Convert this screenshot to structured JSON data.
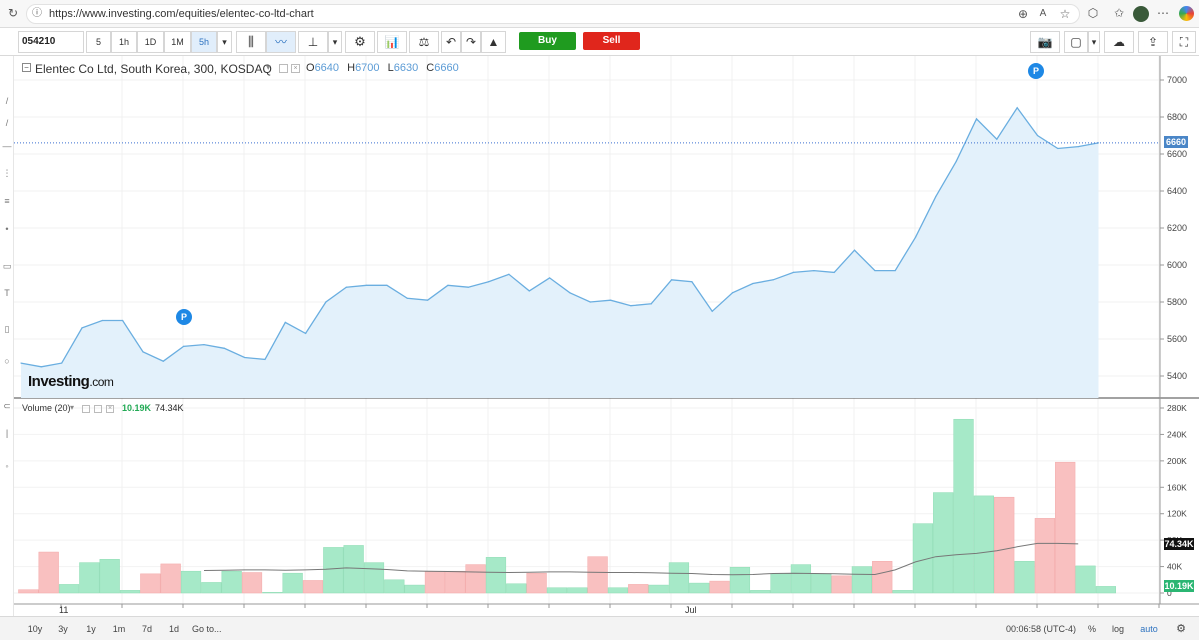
{
  "browser": {
    "url": "https://www.investing.com/equities/elentec-co-ltd-chart"
  },
  "toolbar": {
    "symbol": "054210",
    "intervals": [
      "5",
      "1h",
      "1D",
      "1M",
      "5h"
    ],
    "active_interval": "5h",
    "buy_label": "Buy",
    "sell_label": "Sell"
  },
  "legend": {
    "title": "Elentec Co Ltd, South Korea, 300, KOSDAQ",
    "open_label": "O",
    "open": "6640",
    "high_label": "H",
    "high": "6700",
    "low_label": "L",
    "low": "6630",
    "close_label": "C",
    "close": "6660"
  },
  "volume_legend": {
    "title": "Volume (20)",
    "volume": "10.19K",
    "ma": "74.34K"
  },
  "watermark": {
    "brand": "Investing",
    "suffix": ".com"
  },
  "event_badges": [
    "P",
    "P"
  ],
  "price_badge": "6660",
  "volume_badges": {
    "ma": "74.34K",
    "volume": "10.19K"
  },
  "x_labels": [
    "11",
    "Jul"
  ],
  "bottom_bar": {
    "ranges": [
      "10y",
      "3y",
      "1y",
      "1m",
      "7d",
      "1d"
    ],
    "goto": "Go to...",
    "time": "00:06:58 (UTC-4)",
    "percent": "%",
    "log": "log",
    "auto": "auto"
  },
  "colors": {
    "price_line": "#6aaee0",
    "price_fill": "#e3f1fb",
    "vol_up": "#a6e9c8",
    "vol_down": "#f9c0c0",
    "buy": "#1f9b1f",
    "sell": "#e0261c",
    "badge_blue": "#1e88e5"
  },
  "chart_data": [
    {
      "type": "area",
      "title": "Elentec Co Ltd, South Korea, 300, KOSDAQ",
      "y_ticks": [
        5400,
        5600,
        5800,
        6000,
        6200,
        6400,
        6600,
        6800,
        7000
      ],
      "ylim": [
        5290,
        7090
      ],
      "values": [
        5470,
        5450,
        5470,
        5660,
        5700,
        5700,
        5530,
        5480,
        5560,
        5570,
        5550,
        5500,
        5490,
        5690,
        5630,
        5800,
        5880,
        5890,
        5890,
        5820,
        5810,
        5890,
        5880,
        5910,
        5950,
        5860,
        5930,
        5850,
        5800,
        5810,
        5780,
        5790,
        5920,
        5910,
        5750,
        5850,
        5900,
        5920,
        5960,
        5970,
        5960,
        6080,
        5970,
        5970,
        6150,
        6370,
        6560,
        6790,
        6680,
        6850,
        6700,
        6630,
        6640,
        6660
      ],
      "last_price_line": 6660,
      "grid": true
    },
    {
      "type": "bar",
      "title": "Volume (20)",
      "y_ticks": [
        "0",
        "40K",
        "80K",
        "120K",
        "160K",
        "200K",
        "240K",
        "280K"
      ],
      "ylim": [
        0,
        285000
      ],
      "volumes": [
        5000,
        62000,
        13000,
        46000,
        51000,
        4000,
        29000,
        44000,
        33000,
        16000,
        33000,
        31000,
        1000,
        30000,
        19000,
        69000,
        72000,
        46000,
        20000,
        12000,
        33000,
        33000,
        43000,
        54000,
        14000,
        30000,
        8000,
        8000,
        55000,
        8000,
        13000,
        12000,
        46000,
        15000,
        18000,
        39000,
        4000,
        29000,
        43000,
        29000,
        26000,
        40000,
        48000,
        4000,
        105000,
        152000,
        263000,
        147000,
        145000,
        48000,
        113000,
        198000,
        41000,
        10000
      ],
      "directions": [
        "d",
        "d",
        "u",
        "u",
        "u",
        "u",
        "d",
        "d",
        "u",
        "u",
        "u",
        "d",
        "u",
        "u",
        "d",
        "u",
        "u",
        "u",
        "u",
        "u",
        "d",
        "d",
        "d",
        "u",
        "u",
        "d",
        "u",
        "u",
        "d",
        "u",
        "d",
        "u",
        "u",
        "u",
        "d",
        "u",
        "u",
        "u",
        "u",
        "u",
        "d",
        "u",
        "d",
        "u",
        "u",
        "u",
        "u",
        "u",
        "d",
        "u",
        "d",
        "d",
        "u",
        "u"
      ],
      "ma_series": {
        "name": "Volume (20)",
        "start_index": 9,
        "values": [
          34000,
          34500,
          35000,
          35000,
          34500,
          35000,
          36000,
          38000,
          37000,
          35500,
          33500,
          33000,
          32500,
          32000,
          31500,
          31000,
          31500,
          32000,
          32000,
          31500,
          31000,
          31000,
          30500,
          30000,
          29500,
          28000,
          27500,
          28000,
          29500,
          30000,
          29500,
          29000,
          28500,
          28000,
          35000,
          47000,
          55000,
          58000,
          60000,
          64000,
          70000,
          75000,
          75000,
          74340
        ]
      }
    }
  ]
}
